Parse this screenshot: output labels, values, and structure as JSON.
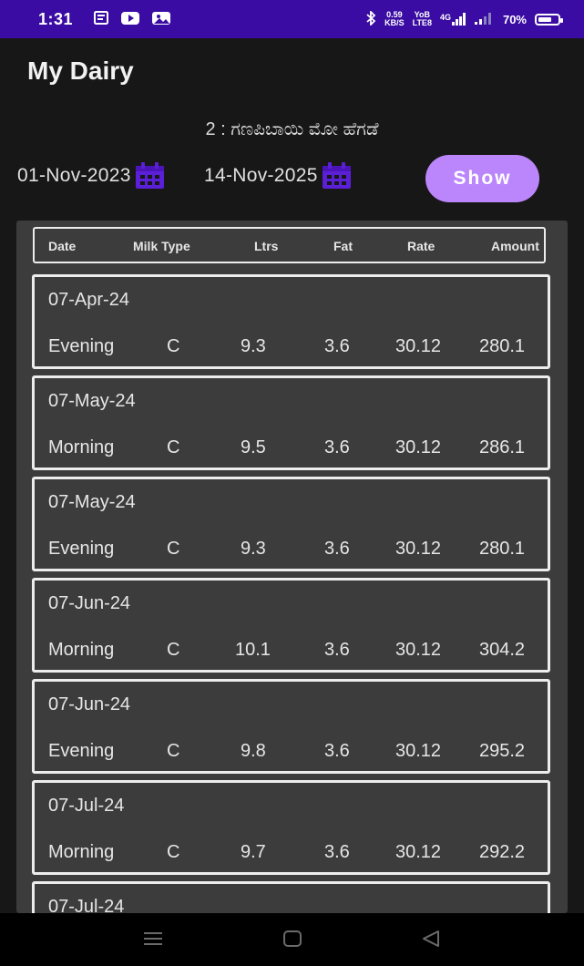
{
  "status_bar": {
    "time": "1:31",
    "left_icons": [
      "notes-icon",
      "youtube-icon",
      "gallery-icon"
    ],
    "net_speed": "0.59",
    "net_unit": "KB/S",
    "volte_top": "YoB",
    "volte_bottom": "LTE8",
    "network": "4G",
    "battery": "70%",
    "battery_level": 0.7
  },
  "app": {
    "title": "My Dairy",
    "customer": "2 : ಗಣಪಿಬಾಯಿ ಮೋ ಹೆಗಡೆ"
  },
  "filter": {
    "from_date": "01-Nov-2023",
    "to_date": "14-Nov-2025",
    "show_label": "Show"
  },
  "table": {
    "headers": [
      "Date",
      "Milk Type",
      "Ltrs",
      "Fat",
      "Rate",
      "Amount"
    ],
    "records": [
      {
        "date": "07-Apr-24",
        "shift": "Evening",
        "type": "C",
        "ltrs": "9.3",
        "fat": "3.6",
        "rate": "30.12",
        "amount": "280.1"
      },
      {
        "date": "07-May-24",
        "shift": "Morning",
        "type": "C",
        "ltrs": "9.5",
        "fat": "3.6",
        "rate": "30.12",
        "amount": "286.1"
      },
      {
        "date": "07-May-24",
        "shift": "Evening",
        "type": "C",
        "ltrs": "9.3",
        "fat": "3.6",
        "rate": "30.12",
        "amount": "280.1"
      },
      {
        "date": "07-Jun-24",
        "shift": "Morning",
        "type": "C",
        "ltrs": "10.1",
        "fat": "3.6",
        "rate": "30.12",
        "amount": "304.2"
      },
      {
        "date": "07-Jun-24",
        "shift": "Evening",
        "type": "C",
        "ltrs": "9.8",
        "fat": "3.6",
        "rate": "30.12",
        "amount": "295.2"
      },
      {
        "date": "07-Jul-24",
        "shift": "Morning",
        "type": "C",
        "ltrs": "9.7",
        "fat": "3.6",
        "rate": "30.12",
        "amount": "292.2"
      },
      {
        "date": "07-Jul-24",
        "shift": "",
        "type": "",
        "ltrs": "",
        "fat": "",
        "rate": "",
        "amount": ""
      }
    ]
  },
  "colors": {
    "status_bar": "#3a0ca3",
    "accent": "#bb86fc",
    "calendar_icon": "#5b1fd6",
    "background": "#171717",
    "panel": "#3c3c3c"
  }
}
